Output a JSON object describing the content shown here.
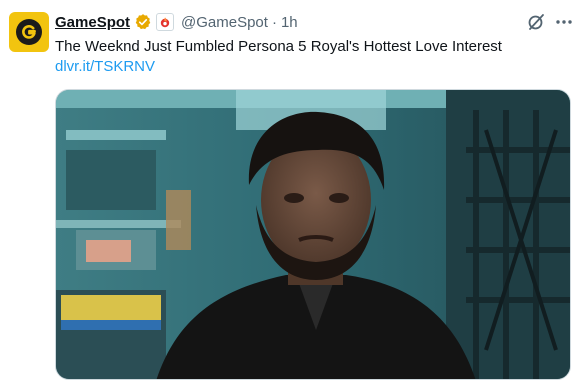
{
  "tweet": {
    "author_name": "GameSpot",
    "author_handle": "@GameSpot",
    "separator": "·",
    "time": "1h",
    "text": "The Weeknd Just Fumbled Persona 5 Royal's Hottest Love Interest",
    "link": "dlvr.it/TSKRNV"
  },
  "icons": {
    "avatar": "gamespot-logo-icon",
    "verified": "verified-badge-icon",
    "affiliate": "affiliate-badge-icon",
    "grok": "grok-icon",
    "more": "more-icon"
  },
  "colors": {
    "avatar_bg": "#f2c40f",
    "verified": "#e8a900",
    "link": "#1d9bf0",
    "muted": "#536471"
  }
}
